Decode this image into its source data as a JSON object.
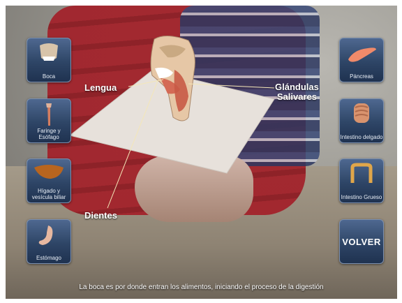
{
  "buttons_left": [
    {
      "label": "Boca",
      "icon": "mouth-icon"
    },
    {
      "label": "Faringe y Esófago",
      "icon": "esophagus-icon"
    },
    {
      "label": "Hígado y vesícula biliar",
      "icon": "liver-icon"
    },
    {
      "label": "Estómago",
      "icon": "stomach-icon"
    }
  ],
  "buttons_right": [
    {
      "label": "Páncreas",
      "icon": "pancreas-icon"
    },
    {
      "label": "Intestino delgado",
      "icon": "small-intestine-icon"
    },
    {
      "label": "Intestino Grueso",
      "icon": "large-intestine-icon"
    }
  ],
  "back_button": {
    "label": "VOLVER"
  },
  "callouts": {
    "lengua": "Lengua",
    "glandulas_1": "Glándulas",
    "glandulas_2": "Salivares",
    "dientes": "Dientes"
  },
  "caption": "La boca es por donde entran los alimentos, iniciando el proceso de la digestión",
  "colors": {
    "button_top": "#4e6890",
    "button_bottom": "#1f3250",
    "label": "#ffffff"
  }
}
